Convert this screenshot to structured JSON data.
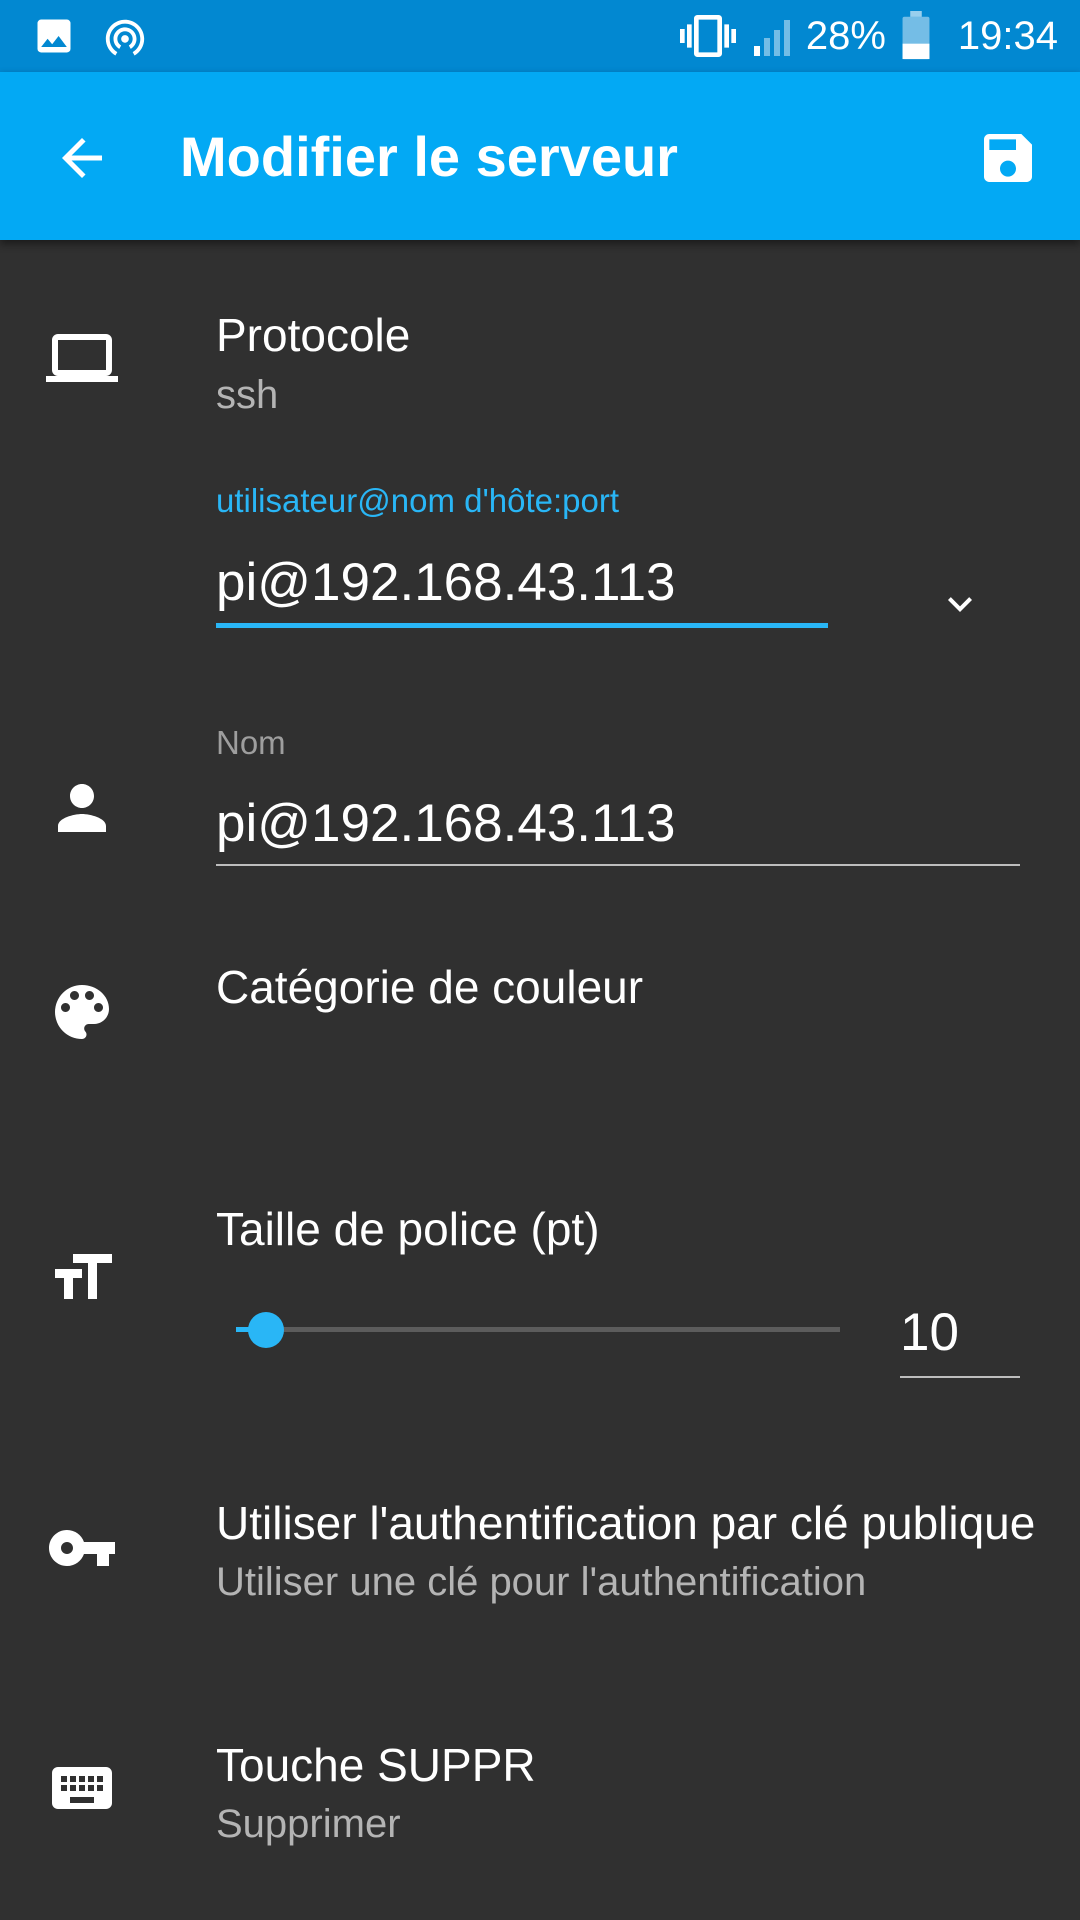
{
  "status_bar": {
    "battery_percent": "28%",
    "time": "19:34",
    "icons": [
      "image-icon",
      "hotspot-icon",
      "vibrate-icon",
      "signal-icon",
      "battery-icon"
    ]
  },
  "app_bar": {
    "title": "Modifier le serveur",
    "back_icon": "arrow-back-icon",
    "save_icon": "save-icon",
    "background_color": "#03a9f4"
  },
  "protocol": {
    "label": "Protocole",
    "value": "ssh",
    "icon": "laptop-icon"
  },
  "host_field": {
    "label": "utilisateur@nom d'hôte:port",
    "value": "pi@192.168.43.113",
    "dropdown_icon": "chevron-down-icon",
    "accent_color": "#29b6f6"
  },
  "name_field": {
    "label": "Nom",
    "value": "pi@192.168.43.113",
    "icon": "person-icon"
  },
  "color_category": {
    "label": "Catégorie de couleur",
    "icon": "palette-icon"
  },
  "font_size": {
    "label": "Taille de police (pt)",
    "value": "10",
    "slider_fraction": 0.05,
    "icon": "text-size-icon"
  },
  "pubkey": {
    "title": "Utiliser l'authentification par clé publique",
    "subtitle": "Utiliser une clé pour l'authentification",
    "icon": "key-icon"
  },
  "delete_key": {
    "title": "Touche SUPPR",
    "subtitle": "Supprimer",
    "icon": "keyboard-icon"
  }
}
